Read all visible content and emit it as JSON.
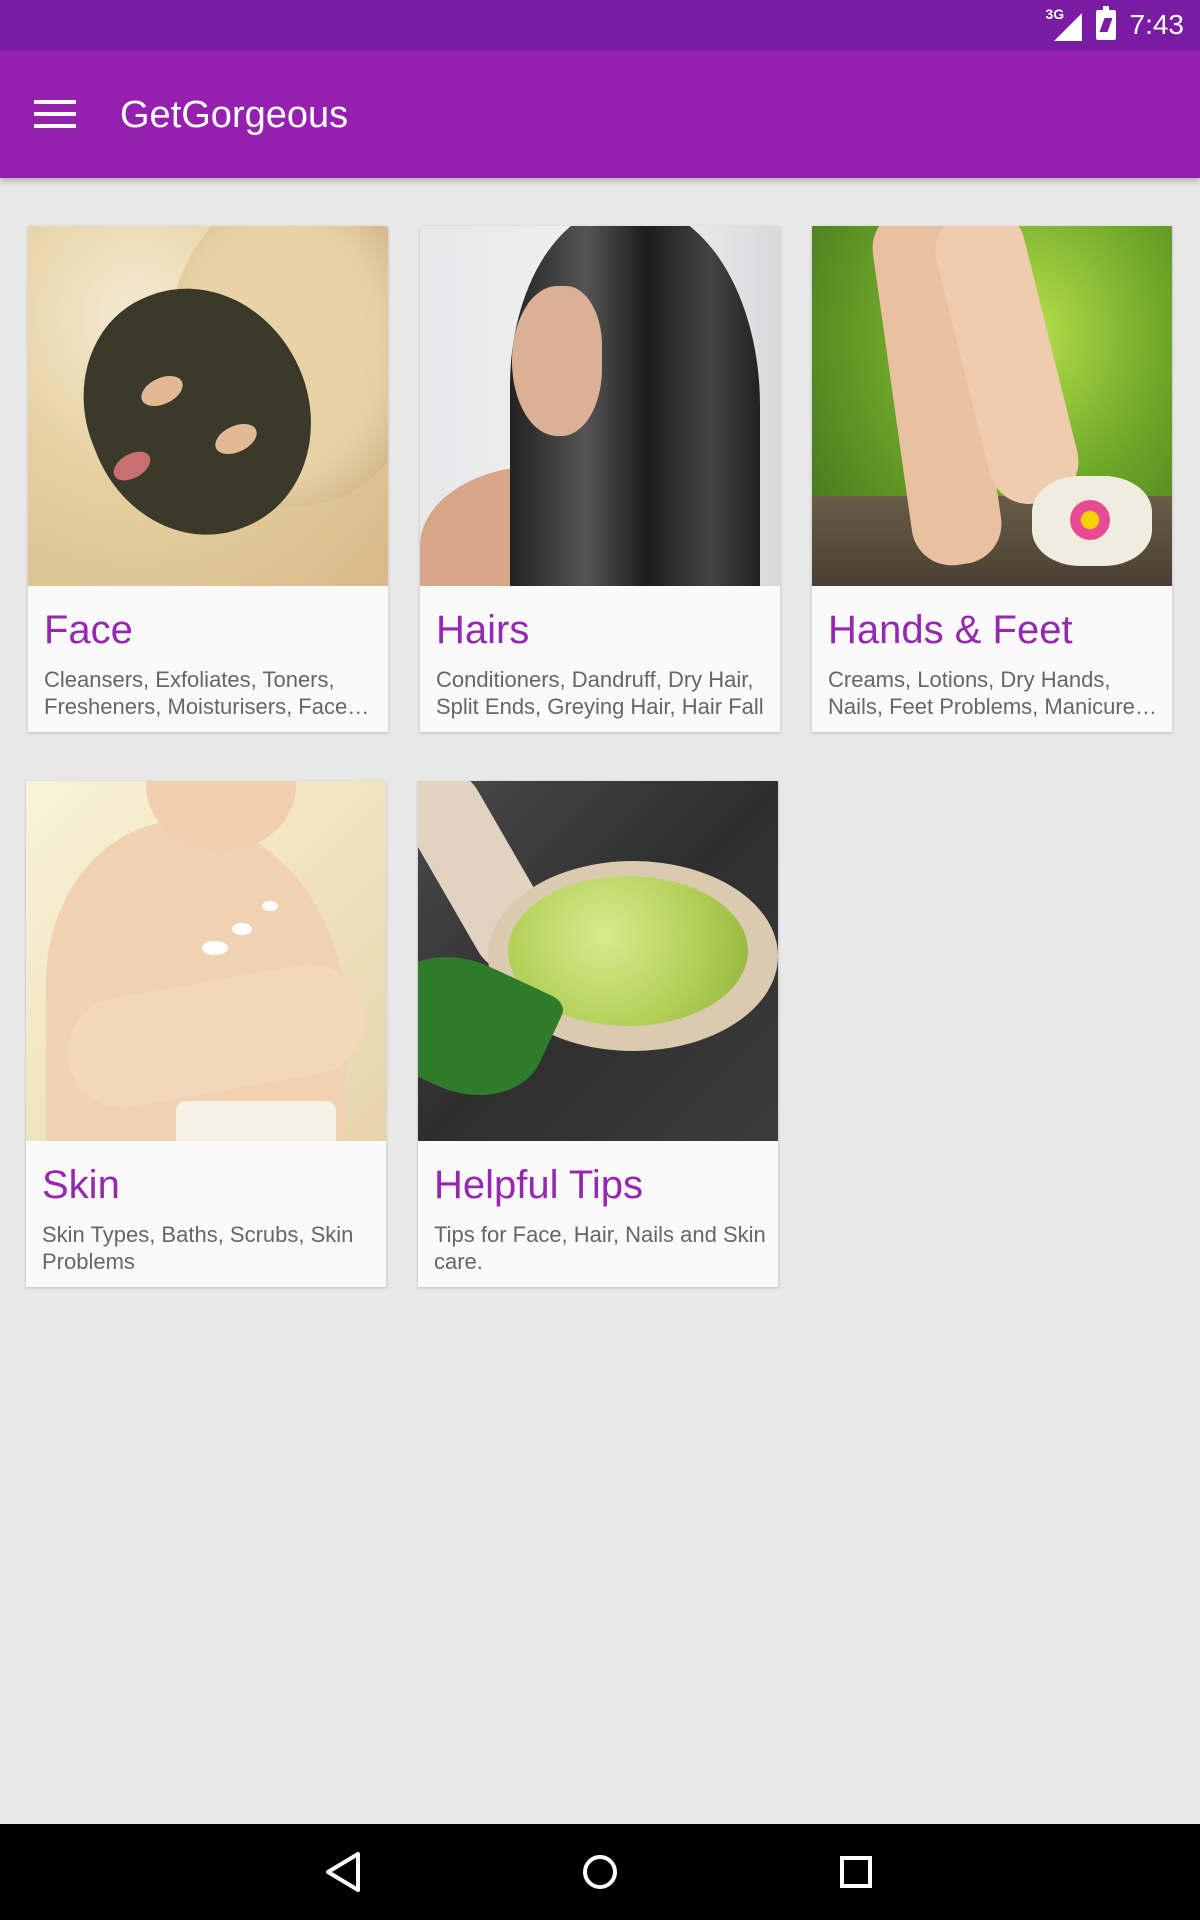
{
  "status_bar": {
    "network": "3G",
    "time": "7:43"
  },
  "app_bar": {
    "title": "GetGorgeous",
    "menu_icon": "hamburger-menu-icon"
  },
  "categories": [
    {
      "title": "Face",
      "description": "Cleansers, Exfoliates, Toners, Fresheners, Moisturisers, Face Packs",
      "image": "face-mask-photo"
    },
    {
      "title": "Hairs",
      "description": "Conditioners, Dandruff, Dry Hair, Split Ends, Greying Hair, Hair Fall",
      "image": "wet-hair-photo"
    },
    {
      "title": "Hands & Feet",
      "description": "Creams, Lotions, Dry Hands, Nails, Feet Problems, Manicure, Pedicure",
      "image": "feet-spa-photo"
    },
    {
      "title": "Skin",
      "description": "Skin Types, Baths, Scrubs, Skin Problems",
      "image": "skin-cream-photo"
    },
    {
      "title": "Helpful Tips",
      "description": "Tips for Face, Hair, Nails and Skin care.",
      "image": "bath-salt-spoon-photo"
    }
  ],
  "nav_bar": {
    "back_icon": "back-triangle-icon",
    "home_icon": "home-circle-icon",
    "recents_icon": "recents-square-icon"
  },
  "colors": {
    "status_bar": "#7a1ba3",
    "app_bar": "#9520b0",
    "accent_title": "#9527b0",
    "background": "#e8e8e8"
  }
}
